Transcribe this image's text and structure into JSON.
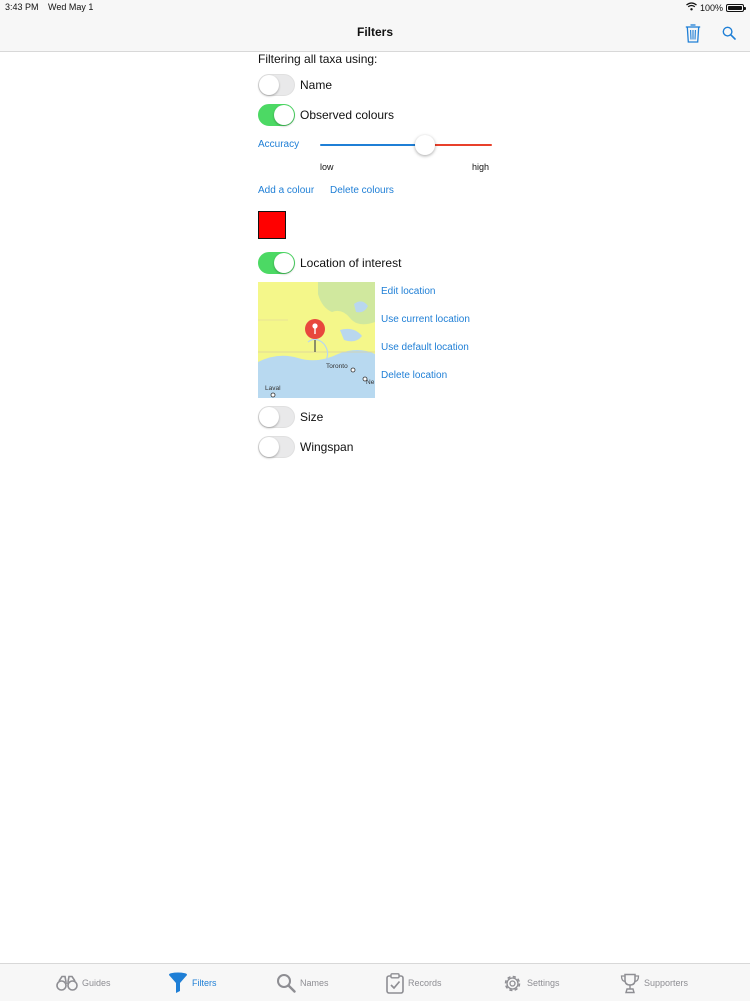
{
  "status_bar": {
    "time": "3:43 PM",
    "date": "Wed May 1",
    "battery": "100%",
    "battery_level": 1.0
  },
  "nav": {
    "title": "Filters",
    "trash_icon": "trash-icon",
    "search_icon": "search-icon"
  },
  "filters": {
    "heading": "Filtering all taxa using:",
    "name": {
      "label": "Name",
      "on": false
    },
    "observed_colours": {
      "label": "Observed colours",
      "on": true
    },
    "accuracy": {
      "label": "Accuracy",
      "value": 0.61,
      "low_label": "low",
      "high_label": "high"
    },
    "add_colour": "Add a colour",
    "delete_colours": "Delete colours",
    "colours": [
      "#ff0000"
    ],
    "location": {
      "label": "Location of interest",
      "on": true,
      "map_labels": {
        "city1": "Toronto",
        "city2": "Laval",
        "city3": "Ne"
      },
      "actions": [
        "Edit location",
        "Use current location",
        "Use default location",
        "Delete location"
      ]
    },
    "size": {
      "label": "Size",
      "on": false
    },
    "wingspan": {
      "label": "Wingspan",
      "on": false
    }
  },
  "tabs": [
    {
      "label": "Guides",
      "icon": "binoculars-icon",
      "active": false
    },
    {
      "label": "Filters",
      "icon": "funnel-icon",
      "active": true
    },
    {
      "label": "Names",
      "icon": "magnifier-icon",
      "active": false
    },
    {
      "label": "Records",
      "icon": "clipboard-icon",
      "active": false
    },
    {
      "label": "Settings",
      "icon": "gear-icon",
      "active": false
    },
    {
      "label": "Supporters",
      "icon": "trophy-icon",
      "active": false
    }
  ],
  "colors": {
    "accent": "#1f7fd6",
    "toggle_on": "#4cd964",
    "slider_max": "#e8402b",
    "map_land": "#f4f78a",
    "pin": "#e8473d"
  }
}
